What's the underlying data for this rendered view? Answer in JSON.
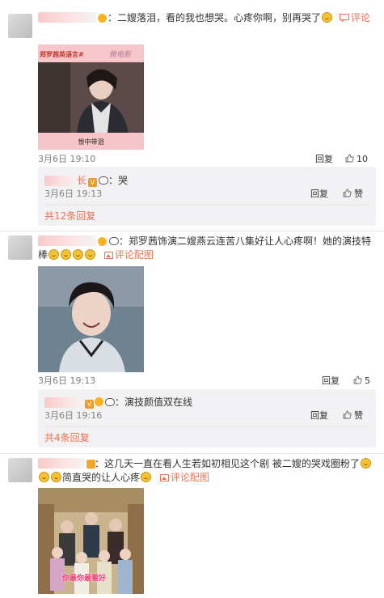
{
  "comments": [
    {
      "text": "：二嫂落泪，看的我也想哭。心疼你啊，别再哭了",
      "comment_link": "评论",
      "image_caption_top": "郑罗茜英语言#",
      "image_caption_bottom": "恨中带泪",
      "image_watermark": "微电影",
      "date": "3月6日 19:10",
      "reply_label": "回复",
      "like_count": "10",
      "replies": [
        {
          "name_tail": "长",
          "text": "：哭",
          "date": "3月6日 19:13",
          "reply_label": "回复",
          "like_label": "赞"
        }
      ],
      "more_replies": "共12条回复"
    },
    {
      "text": "：郑罗茜饰演二嫂燕云连苦八集好让人心疼啊！她的演技特",
      "text_line2": "棒",
      "comment_link": "评论配图",
      "date": "3月6日 19:13",
      "reply_label": "回复",
      "like_count": "5",
      "replies": [
        {
          "text": "：演技颜值双在线",
          "date": "3月6日 19:16",
          "reply_label": "回复",
          "like_label": "赞"
        }
      ],
      "more_replies": "共4条回复"
    },
    {
      "text": "：这几天一直在看人生若如初相见这个剧 被二嫂的哭戏圈粉了",
      "text_line2": "简直哭的让人心疼",
      "comment_link": "评论配图",
      "image_caption": "你最你最看好"
    }
  ],
  "colors": {
    "link": "#eb7350",
    "muted": "#808080",
    "reply_bg": "#f2f2f5",
    "pink": "#f7bfc3"
  }
}
